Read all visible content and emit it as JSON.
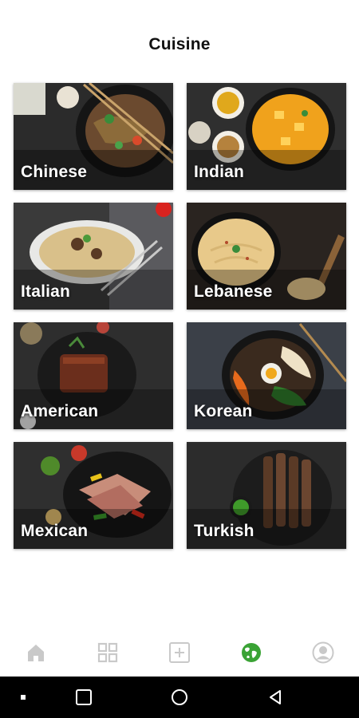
{
  "page": {
    "title": "Cuisine"
  },
  "cuisines": [
    {
      "label": "Chinese"
    },
    {
      "label": "Indian"
    },
    {
      "label": "Italian"
    },
    {
      "label": "Lebanese"
    },
    {
      "label": "American"
    },
    {
      "label": "Korean"
    },
    {
      "label": "Mexican"
    },
    {
      "label": "Turkish"
    }
  ],
  "tabbar": {
    "items": [
      {
        "icon": "home-icon",
        "active": false
      },
      {
        "icon": "grid-icon",
        "active": false
      },
      {
        "icon": "add-icon",
        "active": false
      },
      {
        "icon": "globe-icon",
        "active": true
      },
      {
        "icon": "profile-icon",
        "active": false
      }
    ],
    "active_color": "#3aa335",
    "inactive_color": "#c9c9c9"
  },
  "system_nav": {
    "items": [
      {
        "icon": "dot-icon"
      },
      {
        "icon": "recents-square-icon"
      },
      {
        "icon": "home-circle-icon"
      },
      {
        "icon": "back-triangle-icon"
      }
    ]
  }
}
